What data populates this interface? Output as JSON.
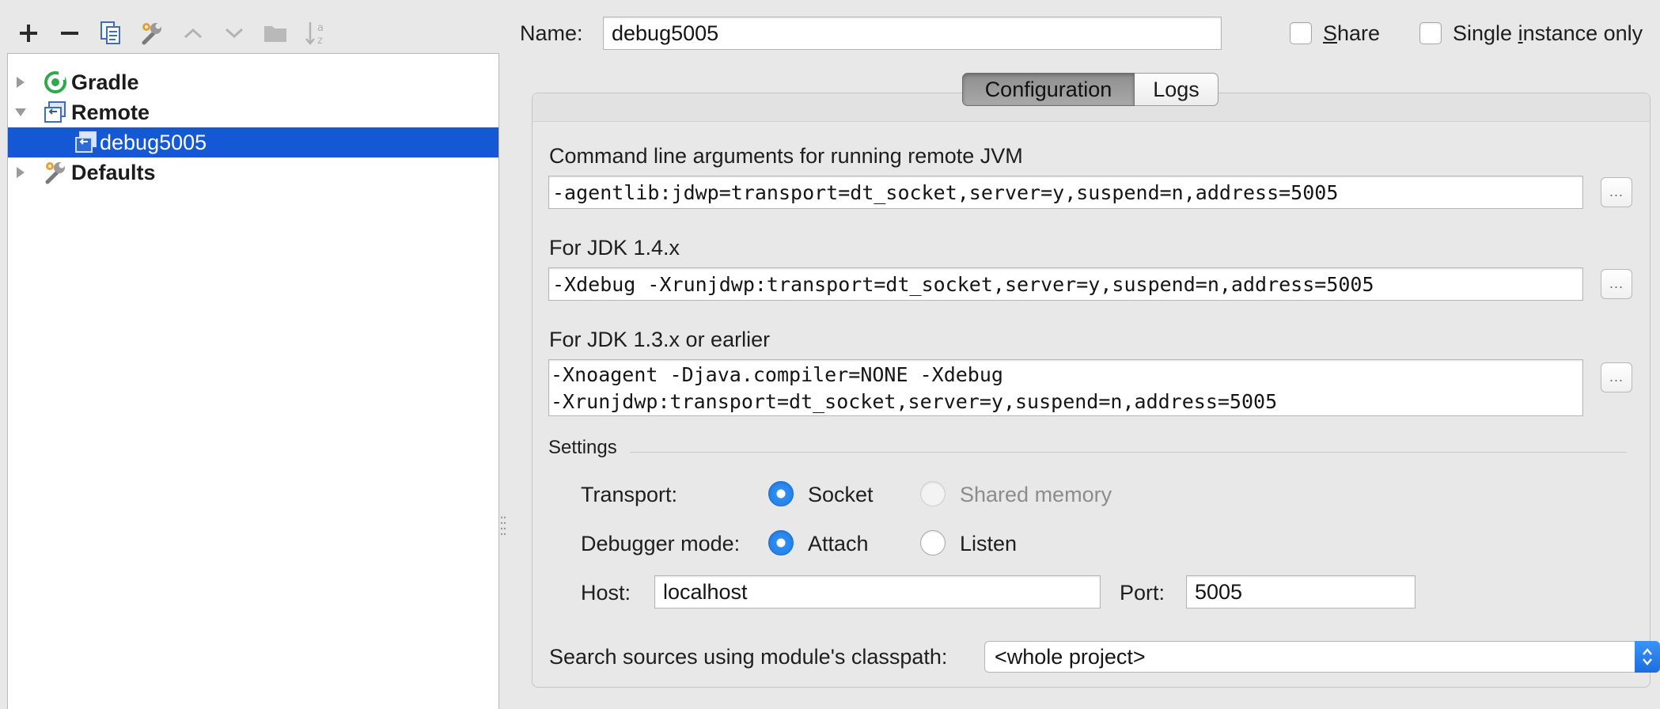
{
  "toolbar": {
    "items": [
      {
        "name": "add-icon"
      },
      {
        "name": "remove-icon"
      },
      {
        "name": "copy-icon"
      },
      {
        "name": "edit-defaults-icon"
      },
      {
        "name": "move-up-icon"
      },
      {
        "name": "move-down-icon"
      },
      {
        "name": "folder-icon"
      },
      {
        "name": "sort-icon"
      }
    ]
  },
  "tree": {
    "items": [
      {
        "label": "Gradle",
        "expanded": false,
        "selected": false,
        "icon": "gradle-icon"
      },
      {
        "label": "Remote",
        "expanded": true,
        "selected": false,
        "icon": "remote-icon"
      },
      {
        "label": "debug5005",
        "selected": true,
        "icon": "remote-config-icon"
      },
      {
        "label": "Defaults",
        "expanded": false,
        "selected": false,
        "icon": "wrench-icon"
      }
    ]
  },
  "header": {
    "name_label": "Name:",
    "name_value": "debug5005",
    "share_label": "Share",
    "single_instance_label": "Single instance only"
  },
  "tabs": [
    {
      "label": "Configuration",
      "active": true
    },
    {
      "label": "Logs",
      "active": false
    }
  ],
  "config": {
    "cmd_label": "Command line arguments for running remote JVM",
    "cmd_value": "-agentlib:jdwp=transport=dt_socket,server=y,suspend=n,address=5005",
    "jdk14_label": "For JDK 1.4.x",
    "jdk14_value": "-Xdebug -Xrunjdwp:transport=dt_socket,server=y,suspend=n,address=5005",
    "jdk13_label": "For JDK 1.3.x or earlier",
    "jdk13_lines": [
      "-Xnoagent -Djava.compiler=NONE -Xdebug",
      "-Xrunjdwp:transport=dt_socket,server=y,suspend=n,address=5005"
    ],
    "ellipsis": "...",
    "settings_label": "Settings",
    "transport_label": "Transport:",
    "transport_options": [
      {
        "label": "Socket",
        "checked": true,
        "enabled": true
      },
      {
        "label": "Shared memory",
        "checked": false,
        "enabled": false
      }
    ],
    "debugger_mode_label": "Debugger mode:",
    "debugger_mode_options": [
      {
        "label": "Attach",
        "checked": true
      },
      {
        "label": "Listen",
        "checked": false
      }
    ],
    "host_label": "Host:",
    "host_value": "localhost",
    "port_label": "Port:",
    "port_value": "5005",
    "search_sources_label": "Search sources using module's classpath:",
    "search_sources_value": "<whole project>"
  },
  "colors": {
    "selection": "#1558d6",
    "radio_checked": "#1f7ce6",
    "combo_arrow": "#1c6ee0"
  }
}
